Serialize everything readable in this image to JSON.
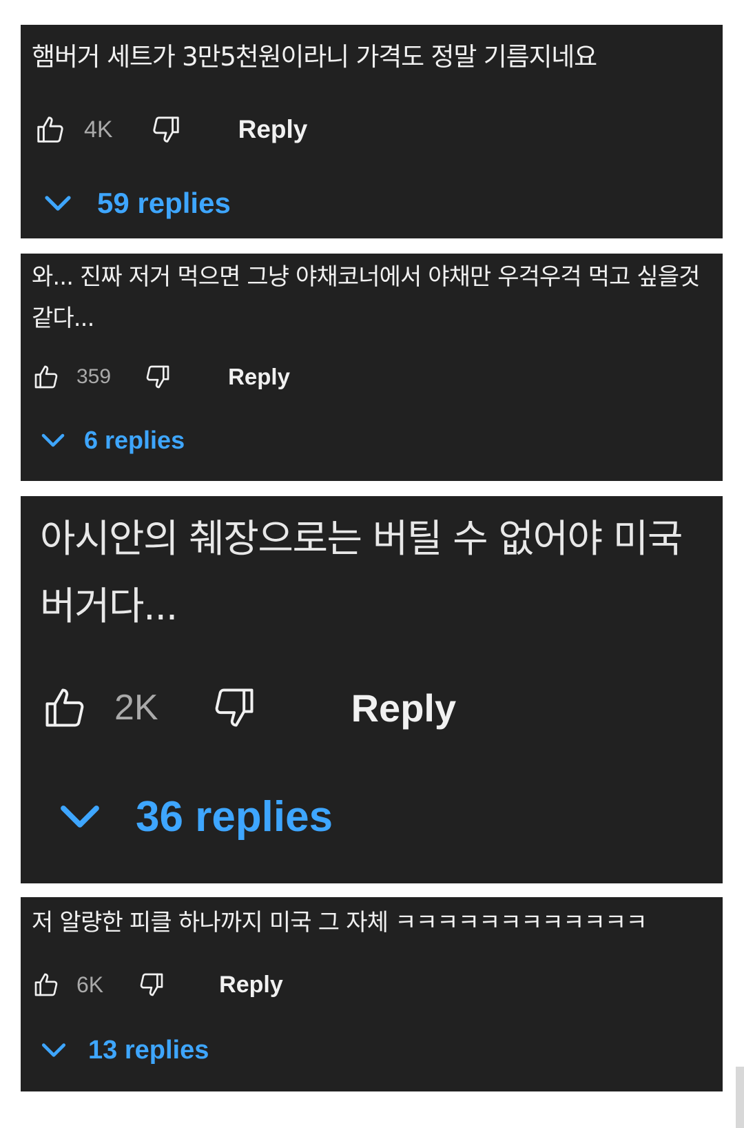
{
  "comments": [
    {
      "text": "햄버거 세트가 3만5천원이라니 가격도 정말 기름지네요",
      "likes": "4K",
      "reply_label": "Reply",
      "replies_label": "59 replies"
    },
    {
      "text": "와... 진짜 저거 먹으면 그냥 야채코너에서 야채만 우걱우걱 먹고 싶을것 같다...",
      "likes": "359",
      "reply_label": "Reply",
      "replies_label": "6 replies"
    },
    {
      "text": "아시안의 췌장으로는 버틸 수 없어야 미국버거다...",
      "likes": "2K",
      "reply_label": "Reply",
      "replies_label": "36 replies"
    },
    {
      "text": "저 알량한 피클 하나까지 미국 그 자체 ㅋㅋㅋㅋㅋㅋㅋㅋㅋㅋㅋㅋ",
      "likes": "6K",
      "reply_label": "Reply",
      "replies_label": "13 replies"
    }
  ],
  "icons": {
    "like": "thumbs-up-icon",
    "dislike": "thumbs-down-icon",
    "expand": "chevron-down-icon"
  },
  "colors": {
    "card_background": "#212121",
    "text": "#f1f1f1",
    "secondary_text": "#aaaaaa",
    "link_blue": "#3ea6ff"
  }
}
